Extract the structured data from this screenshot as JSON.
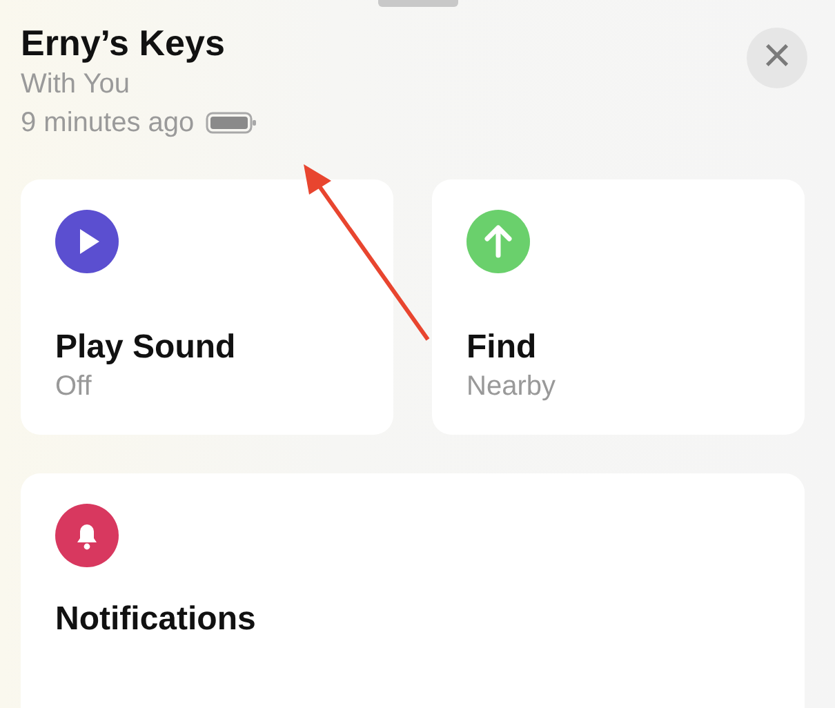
{
  "header": {
    "title": "Erny’s Keys",
    "status": "With You",
    "updated": "9 minutes ago",
    "close": "×"
  },
  "actions": [
    {
      "kind": "play",
      "color": "#5b4fd0",
      "title": "Play Sound",
      "subtitle": "Off"
    },
    {
      "kind": "arrow",
      "color": "#6ad06c",
      "title": "Find",
      "subtitle": "Nearby"
    }
  ],
  "notifications": {
    "kind": "bell",
    "color": "#d8385f",
    "title": "Notifications"
  }
}
